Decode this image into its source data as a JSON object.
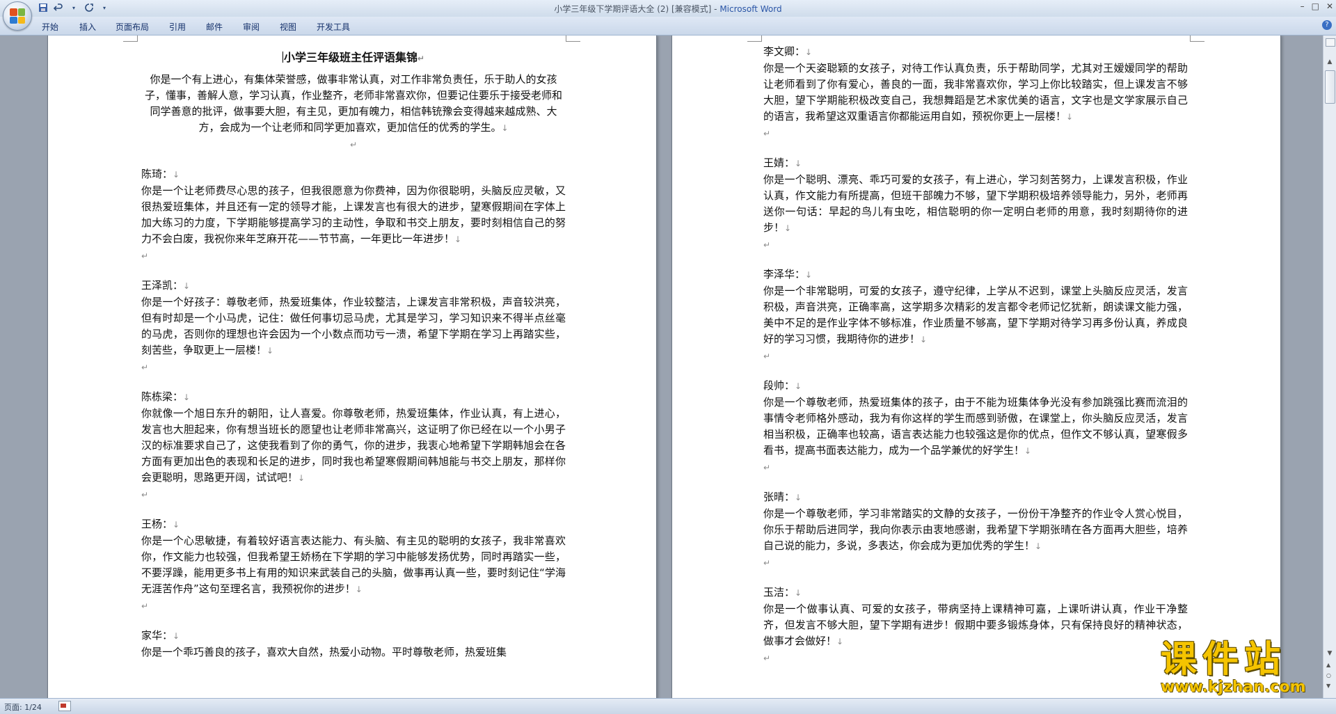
{
  "window": {
    "title_prefix": "小学三年级下学期评语大全 (2) [兼容模式] - ",
    "title_app": "Microsoft Word",
    "controls": [
      "–",
      "□",
      "✕"
    ]
  },
  "quick_access": [
    "save-icon",
    "undo-icon",
    "redo-icon",
    "customize-icon"
  ],
  "ribbon_tabs": [
    "开始",
    "插入",
    "页面布局",
    "引用",
    "邮件",
    "审阅",
    "视图",
    "开发工具"
  ],
  "left_page": {
    "title": "小学三年级班主任评语集锦",
    "intro": "你是一个有上进心，有集体荣誉感，做事非常认真，对工作非常负责任，乐于助人的女孩子，懂事，善解人意，学习认真，作业整齐，老师非常喜欢你，但要记住要乐于接受老师和同学善意的批评，做事要大胆，有主见，更加有魄力，相信韩铳豫会变得越来越成熟、大方，会成为一个让老师和同学更加喜欢，更加信任的优秀的学生。",
    "entries": [
      {
        "name": "陈琦：",
        "text": "你是一个让老师费尽心思的孩子，但我很愿意为你费神，因为你很聪明，头脑反应灵敏，又很热爱班集体，并且还有一定的领导才能，上课发言也有很大的进步，望寒假期间在字体上加大练习的力度，下学期能够提高学习的主动性，争取和书交上朋友，要时刻相信自己的努力不会白废，我祝你来年芝麻开花——节节高，一年更比一年进步！"
      },
      {
        "name": "王泽凯：",
        "text": "你是一个好孩子：尊敬老师，热爱班集体，作业较整洁，上课发言非常积极，声音较洪亮，但有时却是一个小马虎，记住：做任何事切忌马虎，尤其是学习，学习知识来不得半点丝毫的马虎，否则你的理想也许会因为一个小数点而功亏一溃，希望下学期在学习上再踏实些，刻苦些，争取更上一层楼！"
      },
      {
        "name": "陈栋梁：",
        "text": "你就像一个旭日东升的朝阳，让人喜爱。你尊敬老师，热爱班集体，作业认真，有上进心，发言也大胆起来，你有想当班长的愿望也让老师非常高兴，这证明了你已经在以一个小男子汉的标准要求自己了，这使我看到了你的勇气，你的进步，我衷心地希望下学期韩旭会在各方面有更加出色的表现和长足的进步，同时我也希望寒假期间韩旭能与书交上朋友，那样你会更聪明，思路更开阔，试试吧！"
      },
      {
        "name": "王杨：",
        "text": "你是一个心思敏捷，有着较好语言表达能力、有头脑、有主见的聪明的女孩子，我非常喜欢你，作文能力也较强，但我希望王娇杨在下学期的学习中能够发扬优势，同时再踏实一些，不要浮躁，能用更多书上有用的知识来武装自己的头脑，做事再认真一些，要时刻记住“学海无涯苦作舟”这句至理名言，我预祝你的进步！"
      },
      {
        "name": "家华：",
        "text": "你是一个乖巧善良的孩子，喜欢大自然，热爱小动物。平时尊敬老师，热爱班集"
      }
    ]
  },
  "right_page": {
    "entries": [
      {
        "name": "李文卿：",
        "text": "你是一个天姿聪颖的女孩子，对待工作认真负责，乐于帮助同学，尤其对王嫒嫒同学的帮助让老师看到了你有爱心，善良的一面，我非常喜欢你，学习上你比较踏实，但上课发言不够大胆，望下学期能积极改变自己，我想舞蹈是艺术家优美的语言，文字也是文学家展示自己的语言，我希望这双重语言你都能运用自如，预祝你更上一层楼！"
      },
      {
        "name": "王婧：",
        "text": "你是一个聪明、漂亮、乖巧可爱的女孩子，有上进心，学习刻苦努力，上课发言积极，作业认真，作文能力有所提高，但班干部魄力不够，望下学期积极培养领导能力，另外，老师再送你一句话：早起的鸟儿有虫吃，相信聪明的你一定明白老师的用意，我时刻期待你的进步！"
      },
      {
        "name": "李泽华：",
        "text": "你是一个非常聪明，可爱的女孩子，遵守纪律，上学从不迟到，课堂上头脑反应灵活，发言积极，声音洪亮，正确率高，这学期多次精彩的发言都令老师记忆犹新，朗读课文能力强，美中不足的是作业字体不够标准，作业质量不够高，望下学期对待学习再多份认真，养成良好的学习习惯，我期待你的进步！"
      },
      {
        "name": "段帅：",
        "text": "你是一个尊敬老师，热爱班集体的孩子，由于不能为班集体争光没有参加跳强比赛而流泪的事情令老师格外感动，我为有你这样的学生而感到骄傲，在课堂上，你头脑反应灵活，发言相当积极，正确率也较高，语言表达能力也较强这是你的优点，但作文不够认真，望寒假多看书，提高书面表达能力，成为一个品学兼优的好学生！"
      },
      {
        "name": "张晴：",
        "text": "你是一个尊敬老师，学习非常踏实的文静的女孩子，一份份干净整齐的作业令人赏心悦目，你乐于帮助后进同学，我向你表示由衷地感谢，我希望下学期张晴在各方面再大胆些，培养自己说的能力，多说，多表达，你会成为更加优秀的学生！"
      },
      {
        "name": "玉洁：",
        "text": "你是一个做事认真、可爱的女孩子，带病坚持上课精神可嘉，上课听讲认真，作业干净整齐，但发言不够大胆，望下学期有进步！假期中要多锻炼身体，只有保持良好的精神状态，做事才会做好！"
      }
    ]
  },
  "status": {
    "page": "页面: 1/24"
  },
  "watermark": {
    "title": "课件站",
    "url": "www.kjzhan.com"
  },
  "colors": {
    "brand": "#2a55a6",
    "watermark": "#f5c400"
  }
}
